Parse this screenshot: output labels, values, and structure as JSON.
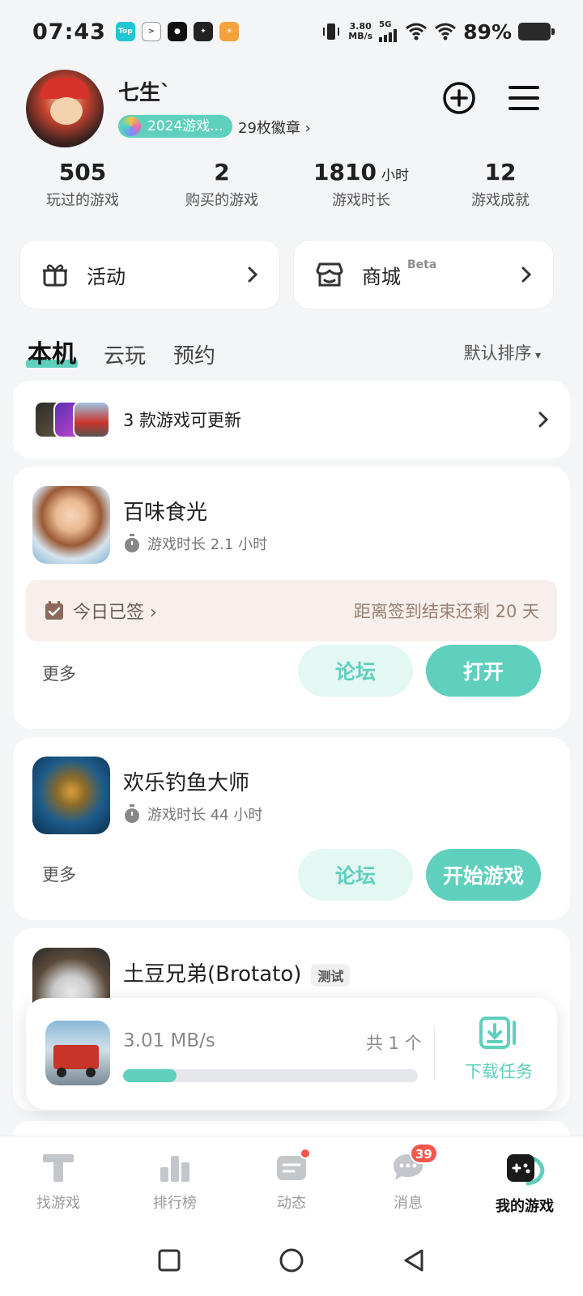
{
  "status_bar": {
    "time": "07:43",
    "net_speed_value": "3.80",
    "net_speed_unit": "MB/s",
    "network": "5G",
    "battery": "89%",
    "app_icons": [
      "top-app-icon",
      "terminal-app-icon",
      "qq-app-icon",
      "chat-app-icon",
      "bulb-app-icon"
    ]
  },
  "profile": {
    "username": "七生`",
    "badge_label": "2024游戏...",
    "badge_count": "29枚徽章"
  },
  "stats": [
    {
      "value": "505",
      "unit": "",
      "label": "玩过的游戏"
    },
    {
      "value": "2",
      "unit": "",
      "label": "购买的游戏"
    },
    {
      "value": "1810",
      "unit": "小时",
      "label": "游戏时长"
    },
    {
      "value": "12",
      "unit": "",
      "label": "游戏成就"
    }
  ],
  "quick_links": {
    "activity": "活动",
    "store": "商城",
    "store_tag": "Beta"
  },
  "tabs": [
    "本机",
    "云玩",
    "预约"
  ],
  "sort_label": "默认排序",
  "update_notice": "3 款游戏可更新",
  "games": [
    {
      "name": "百味食光",
      "playtime": "游戏时长 2.1 小时",
      "signin_label": "今日已签",
      "signin_remaining": "距离签到结束还剩 20 天",
      "more": "更多",
      "forum": "论坛",
      "action": "打开"
    },
    {
      "name": "欢乐钓鱼大师",
      "playtime": "游戏时长 44 小时",
      "more": "更多",
      "forum": "论坛",
      "action": "开始游戏"
    },
    {
      "name": "土豆兄弟(Brotato)",
      "tag": "测试"
    }
  ],
  "download": {
    "speed": "3.01 MB/s",
    "total": "共 1 个",
    "progress_fraction": 0.18,
    "task_label": "下载任务"
  },
  "bottom_nav": [
    {
      "label": "找游戏",
      "icon": "t-icon"
    },
    {
      "label": "排行榜",
      "icon": "ranking-icon"
    },
    {
      "label": "动态",
      "icon": "feed-icon",
      "dot": true
    },
    {
      "label": "消息",
      "icon": "message-icon",
      "badge": "39"
    },
    {
      "label": "我的游戏",
      "icon": "gamepad-icon",
      "active": true
    }
  ],
  "colors": {
    "accent": "#5ed0bd",
    "accent_light": "#e3f7f3",
    "alert": "#f4574e"
  }
}
